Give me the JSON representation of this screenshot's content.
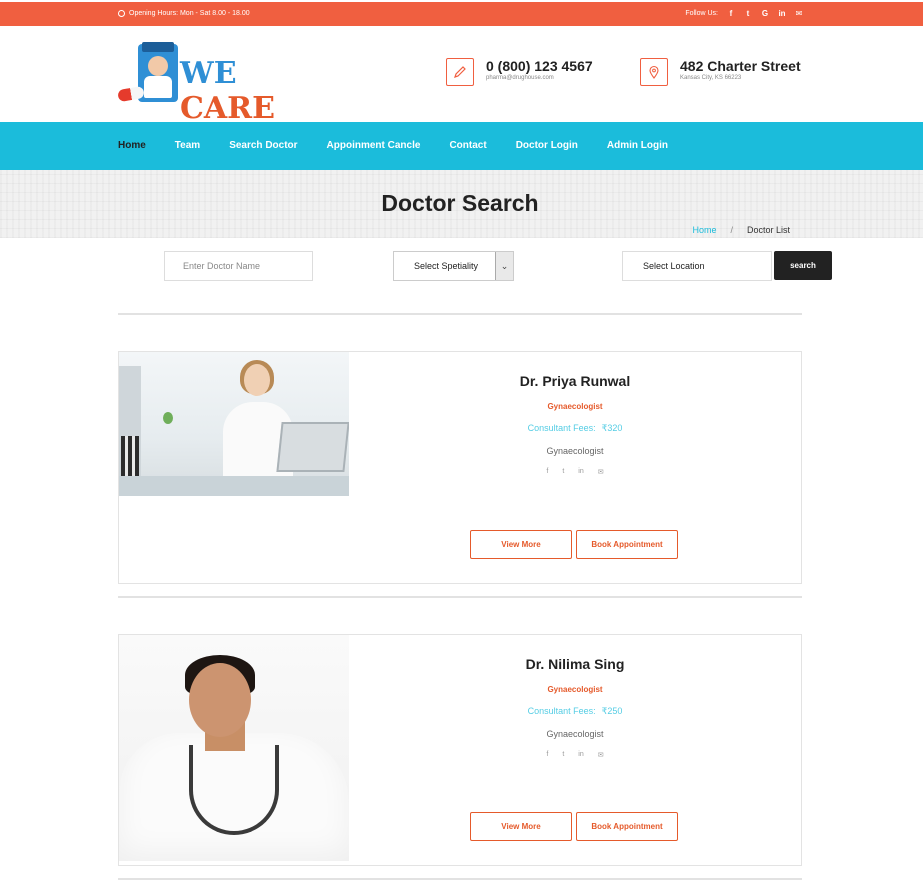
{
  "topbar": {
    "opening_hours": "Opening Hours: Mon - Sat 8.00 - 18.00",
    "follow_label": "Follow Us:",
    "social": [
      "f",
      "t",
      "G",
      "in",
      "✉"
    ]
  },
  "header": {
    "logo_we": "WE",
    "logo_care": "CARE",
    "phone": "0 (800) 123 4567",
    "email": "pharma@drughouse.com",
    "address": "482 Charter Street",
    "city": "Kansas City, KS 66223"
  },
  "nav": {
    "items": [
      "Home",
      "Team",
      "Search Doctor",
      "Appoinment Cancle",
      "Contact",
      "Doctor Login",
      "Admin Login"
    ]
  },
  "page": {
    "title": "Doctor Search",
    "breadcrumb_home": "Home",
    "breadcrumb_sep": "/",
    "breadcrumb_current": "Doctor List"
  },
  "search": {
    "name_placeholder": "Enter Doctor Name",
    "speciality_value": "Select Spetiality",
    "location_value": "Select Location",
    "button": "search"
  },
  "doctors": [
    {
      "name": "Dr. Priya Runwal",
      "speciality": "Gynaecologist",
      "fees_label": "Consultant Fees:",
      "fees_value": "₹320",
      "description": "Gynaecologist",
      "view_more": "View More",
      "book": "Book Appointment"
    },
    {
      "name": "Dr. Nilima Sing",
      "speciality": "Gynaecologist",
      "fees_label": "Consultant Fees:",
      "fees_value": "₹250",
      "description": "Gynaecologist",
      "view_more": "View More",
      "book": "Book Appointment"
    }
  ],
  "card_social": [
    "f",
    "t",
    "in",
    "✉"
  ],
  "colors": {
    "accent": "#f05f40",
    "nav": "#1bbcdb",
    "dark": "#222222"
  }
}
